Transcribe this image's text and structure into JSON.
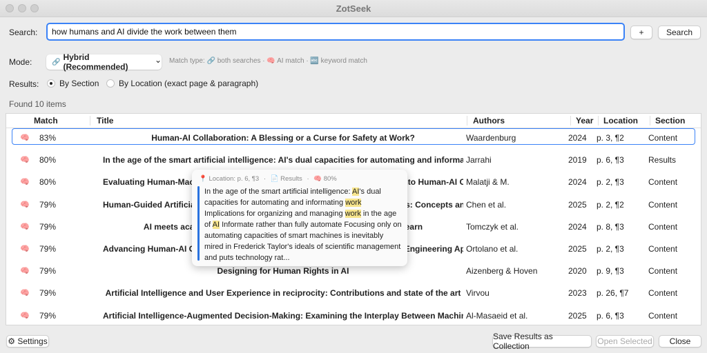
{
  "window": {
    "title": "ZotSeek"
  },
  "search": {
    "label": "Search:",
    "value": "how humans and AI divide the work between them",
    "add_label": "+",
    "search_label": "Search"
  },
  "mode": {
    "label": "Mode:",
    "icon": "🔗",
    "selected": "Hybrid (Recommended)",
    "chevron": "⌄",
    "match_type": "Match type: 🔗 both searches · 🧠 AI match · 🔤 keyword match"
  },
  "results_mode": {
    "label": "Results:",
    "options": [
      "By Section",
      "By Location (exact page & paragraph)"
    ],
    "selected_index": 0
  },
  "found": "Found 10 items",
  "columns": {
    "match": "Match",
    "title": "Title",
    "authors": "Authors",
    "year": "Year",
    "location": "Location",
    "section": "Section"
  },
  "rows": [
    {
      "icon": "🧠",
      "match": "83%",
      "title": "Human-AI Collaboration: A Blessing or a Curse for Safety at Work?",
      "authors": "Waardenburg",
      "year": "2024",
      "location": "p. 3, ¶2",
      "section": "Content"
    },
    {
      "icon": "🧠",
      "match": "80%",
      "title": "In the age of the smart artificial intelligence: AI's dual capacities for automating and informating work",
      "authors": "Jarrahi",
      "year": "2019",
      "location": "p. 6, ¶3",
      "section": "Results"
    },
    {
      "icon": "🧠",
      "match": "80%",
      "title": "Evaluating Human-Machine Interaction in Human-Robot-AI Teams: Insights into Human-AI Confidence Collaboration",
      "authors": "Malatji & M.",
      "year": "2024",
      "location": "p. 2, ¶3",
      "section": "Content"
    },
    {
      "icon": "🧠",
      "match": "79%",
      "title": "Human-Guided Artificial Intelligence in Research and Development Workflows: Concepts and Prospects",
      "authors": "Chen et al.",
      "year": "2025",
      "location": "p. 2, ¶2",
      "section": "Content"
    },
    {
      "icon": "🧠",
      "match": "79%",
      "title": "AI meets academia: transforming the way we research, teach and learn",
      "authors": "Tomczyk et al.",
      "year": "2024",
      "location": "p. 8, ¶3",
      "section": "Content"
    },
    {
      "icon": "🧠",
      "match": "79%",
      "title": "Advancing Human-AI Collaboration in Software Engineering: Challenges for Engineering Applications",
      "authors": "Ortolano et al.",
      "year": "2025",
      "location": "p. 2, ¶3",
      "section": "Content"
    },
    {
      "icon": "🧠",
      "match": "79%",
      "title": "Designing for Human Rights in AI",
      "authors": "Aizenberg & Hoven",
      "year": "2020",
      "location": "p. 9, ¶3",
      "section": "Content"
    },
    {
      "icon": "🧠",
      "match": "79%",
      "title": "Artificial Intelligence and User Experience in reciprocity: Contributions and state of the art",
      "authors": "Virvou",
      "year": "2023",
      "location": "p. 26, ¶7",
      "section": "Content"
    },
    {
      "icon": "🧠",
      "match": "79%",
      "title": "Artificial Intelligence-Augmented Decision-Making: Examining the Interplay Between Machine Learning Algorithms and Human Judgment",
      "authors": "Al-Masaeid et al.",
      "year": "2025",
      "location": "p. 6, ¶3",
      "section": "Content"
    }
  ],
  "tooltip": {
    "location": "📍 Location: p. 6, ¶3",
    "section": "📄 Results",
    "score": "🧠 80%",
    "segments": [
      {
        "t": "In the age of the smart artificial intelligence: ",
        "h": false
      },
      {
        "t": "AI",
        "h": true
      },
      {
        "t": "'s dual capacities for automating and informating ",
        "h": false
      },
      {
        "t": "work",
        "h": true
      },
      {
        "t": " Implications for organizing and managing ",
        "h": false
      },
      {
        "t": "work",
        "h": true
      },
      {
        "t": " in the age of ",
        "h": false
      },
      {
        "t": "AI",
        "h": true
      },
      {
        "t": " Informate rather than fully automate Focusing only on automating capacities of smart machines is inevitably mired in Frederick Taylor's ideals of scientific management and puts technology rat...",
        "h": false
      }
    ]
  },
  "footer": {
    "settings": "⚙ Settings",
    "save": "Save Results as Collection",
    "open": "Open Selected",
    "close": "Close"
  }
}
